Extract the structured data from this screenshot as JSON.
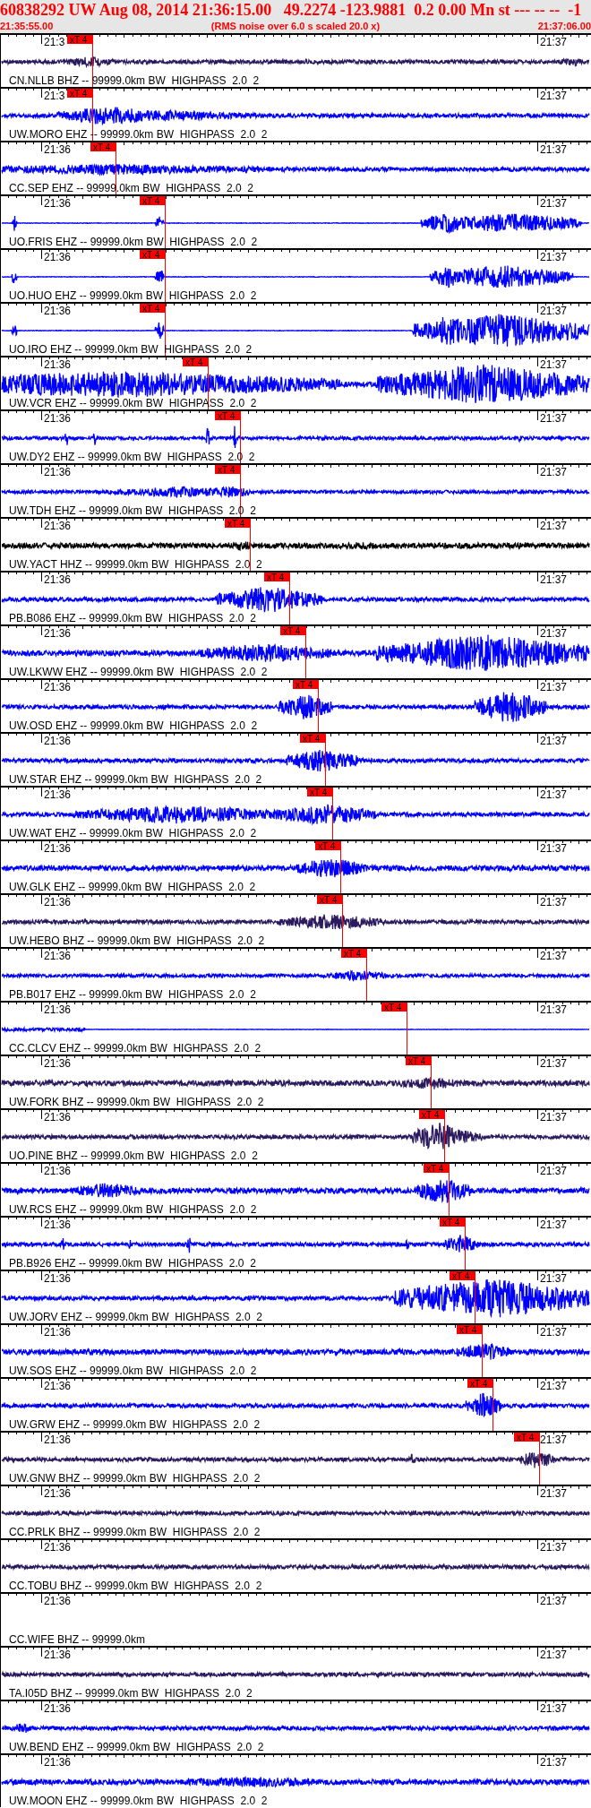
{
  "header": {
    "title": "60838292 UW Aug 08, 2014 21:36:15.00   49.2274 -123.9881  0.2 0.00 Mn st --- -- --  -1",
    "start_time": "21:35:55.00",
    "note": "(RMS noise over 6.0 s scaled 20.0 x)",
    "end_time": "21:37:06.00"
  },
  "traces": [
    {
      "label": "CN.NLLB BHZ -- 99999.0km BW  HIGHPASS  2.0  2",
      "color": "#2b1a5e",
      "ticks": [
        "21:3",
        "21:37"
      ],
      "pick": "xT 4"
    },
    {
      "label": "UW.MORO EHZ -- 99999.0km BW  HIGHPASS  2.0  2",
      "color": "#0000ff",
      "ticks": [
        "21:3",
        "21:37"
      ],
      "pick": "xT 4"
    },
    {
      "label": "CC.SEP EHZ -- 99999.0km BW  HIGHPASS  2.0  2",
      "color": "#0000ff",
      "ticks": [
        "21:36",
        "21:37"
      ],
      "pick": "xT 4"
    },
    {
      "label": "UO.FRIS EHZ -- 99999.0km BW  HIGHPASS  2.0  2",
      "color": "#0000ff",
      "ticks": [
        "21:36",
        "21:37"
      ],
      "pick": "xT 4"
    },
    {
      "label": "UO.HUO EHZ -- 99999.0km BW  HIGHPASS  2.0  2",
      "color": "#0000ff",
      "ticks": [
        "21:36",
        "21:37"
      ],
      "pick": "xT 4"
    },
    {
      "label": "UO.IRO EHZ -- 99999.0km BW  HIGHPASS  2.0  2",
      "color": "#0000ff",
      "ticks": [
        "21:36",
        "21:37"
      ],
      "pick": "xT 4"
    },
    {
      "label": "UW.VCR EHZ -- 99999.0km BW  HIGHPASS  2.0  2",
      "color": "#0000ff",
      "ticks": [
        "21:36",
        "21:37"
      ],
      "pick": "xT 4"
    },
    {
      "label": "UW.DY2 EHZ -- 99999.0km BW  HIGHPASS  2.0  2",
      "color": "#0000ff",
      "ticks": [
        "21:36",
        "21:37"
      ],
      "pick": "xT 4"
    },
    {
      "label": "UW.TDH EHZ -- 99999.0km BW  HIGHPASS  2.0  2",
      "color": "#0000ff",
      "ticks": [
        "21:36",
        "21:37"
      ],
      "pick": "xT 4"
    },
    {
      "label": "UW.YACT HHZ -- 99999.0km BW  HIGHPASS  2.0  2",
      "color": "#000000",
      "ticks": [
        "21:36",
        "21:37"
      ],
      "pick": "xT 4"
    },
    {
      "label": "PB.B086 EHZ -- 99999.0km BW  HIGHPASS  2.0  2",
      "color": "#0000ff",
      "ticks": [
        "21:36",
        "21:37"
      ],
      "pick": "xT 4"
    },
    {
      "label": "UW.LKWW EHZ -- 99999.0km BW  HIGHPASS  2.0  2",
      "color": "#0000ff",
      "ticks": [
        "21:36",
        "21:37"
      ],
      "pick": "xT 4"
    },
    {
      "label": "UW.OSD EHZ -- 99999.0km BW  HIGHPASS  2.0  2",
      "color": "#0000ff",
      "ticks": [
        "21:36",
        "21:37"
      ],
      "pick": "xT 4"
    },
    {
      "label": "UW.STAR EHZ -- 99999.0km BW  HIGHPASS  2.0  2",
      "color": "#0000ff",
      "ticks": [
        "21:36",
        "21:37"
      ],
      "pick": "xT 4"
    },
    {
      "label": "UW.WAT EHZ -- 99999.0km BW  HIGHPASS  2.0  2",
      "color": "#0000ff",
      "ticks": [
        "21:36",
        "21:37"
      ],
      "pick": "xT 4"
    },
    {
      "label": "UW.GLK EHZ -- 99999.0km BW  HIGHPASS  2.0  2",
      "color": "#0000ff",
      "ticks": [
        "21:36",
        "21:37"
      ],
      "pick": "xT 4"
    },
    {
      "label": "UW.HEBO BHZ -- 99999.0km BW  HIGHPASS  2.0  2",
      "color": "#2b1a5e",
      "ticks": [
        "21:36",
        "21:37"
      ],
      "pick": "xT 4"
    },
    {
      "label": "PB.B017 EHZ -- 99999.0km BW  HIGHPASS  2.0  2",
      "color": "#0000ff",
      "ticks": [
        "21:36",
        "21:37"
      ],
      "pick": "xT 4"
    },
    {
      "label": "CC.CLCV EHZ -- 99999.0km BW  HIGHPASS  2.0  2",
      "color": "#0000ff",
      "ticks": [
        "21:36",
        "21:37"
      ],
      "pick": "xT 4"
    },
    {
      "label": "UW.FORK BHZ -- 99999.0km BW  HIGHPASS  2.0  2",
      "color": "#2b1a5e",
      "ticks": [
        "21:36",
        "21:37"
      ],
      "pick": "xT 4"
    },
    {
      "label": "UO.PINE BHZ -- 99999.0km BW  HIGHPASS  2.0  2",
      "color": "#2b1a5e",
      "ticks": [
        "21:36",
        "21:37"
      ],
      "pick": "xT 4"
    },
    {
      "label": "UW.RCS EHZ -- 99999.0km BW  HIGHPASS  2.0  2",
      "color": "#0000ff",
      "ticks": [
        "21:36",
        "21:37"
      ],
      "pick": "xT 4"
    },
    {
      "label": "PB.B926 EHZ -- 99999.0km BW  HIGHPASS  2.0  2",
      "color": "#0000ff",
      "ticks": [
        "21:36",
        "21:37"
      ],
      "pick": "xT 4"
    },
    {
      "label": "UW.JORV EHZ -- 99999.0km BW  HIGHPASS  2.0  2",
      "color": "#0000ff",
      "ticks": [
        "21:36",
        "21:37"
      ],
      "pick": "xT 4"
    },
    {
      "label": "UW.SOS EHZ -- 99999.0km BW  HIGHPASS  2.0  2",
      "color": "#0000ff",
      "ticks": [
        "21:36",
        "21:37"
      ],
      "pick": "xT 4"
    },
    {
      "label": "UW.GRW EHZ -- 99999.0km BW  HIGHPASS  2.0  2",
      "color": "#0000ff",
      "ticks": [
        "21:36",
        "21:37"
      ],
      "pick": "xT 4"
    },
    {
      "label": "UW.GNW BHZ -- 99999.0km BW  HIGHPASS  2.0  2",
      "color": "#2b1a5e",
      "ticks": [
        "21:36",
        "21:37"
      ],
      "pick": "xT 4"
    },
    {
      "label": "CC.PRLK BHZ -- 99999.0km BW  HIGHPASS  2.0  2",
      "color": "#2b1a5e",
      "ticks": [
        "21:36",
        "21:37"
      ]
    },
    {
      "label": "CC.TOBU BHZ -- 99999.0km BW  HIGHPASS  2.0  2",
      "color": "#2b1a5e",
      "ticks": [
        "21:36",
        "21:37"
      ]
    },
    {
      "label": "CC.WIFE BHZ -- 99999.0km",
      "ticks": [
        "21:36",
        "21:37"
      ]
    },
    {
      "label": "TA.I05D BHZ -- 99999.0km BW  HIGHPASS  2.0  2",
      "color": "#2b1a5e",
      "ticks": [
        "21:36",
        "21:37"
      ]
    },
    {
      "label": "UW.BEND EHZ -- 99999.0km BW  HIGHPASS  2.0  2",
      "color": "#0000ff",
      "ticks": [
        "21:36",
        "21:37"
      ]
    },
    {
      "label": "UW.MOON EHZ -- 99999.0km BW  HIGHPASS  2.0  2",
      "color": "#0000ff",
      "ticks": [
        "21:36",
        "21:37"
      ]
    }
  ]
}
